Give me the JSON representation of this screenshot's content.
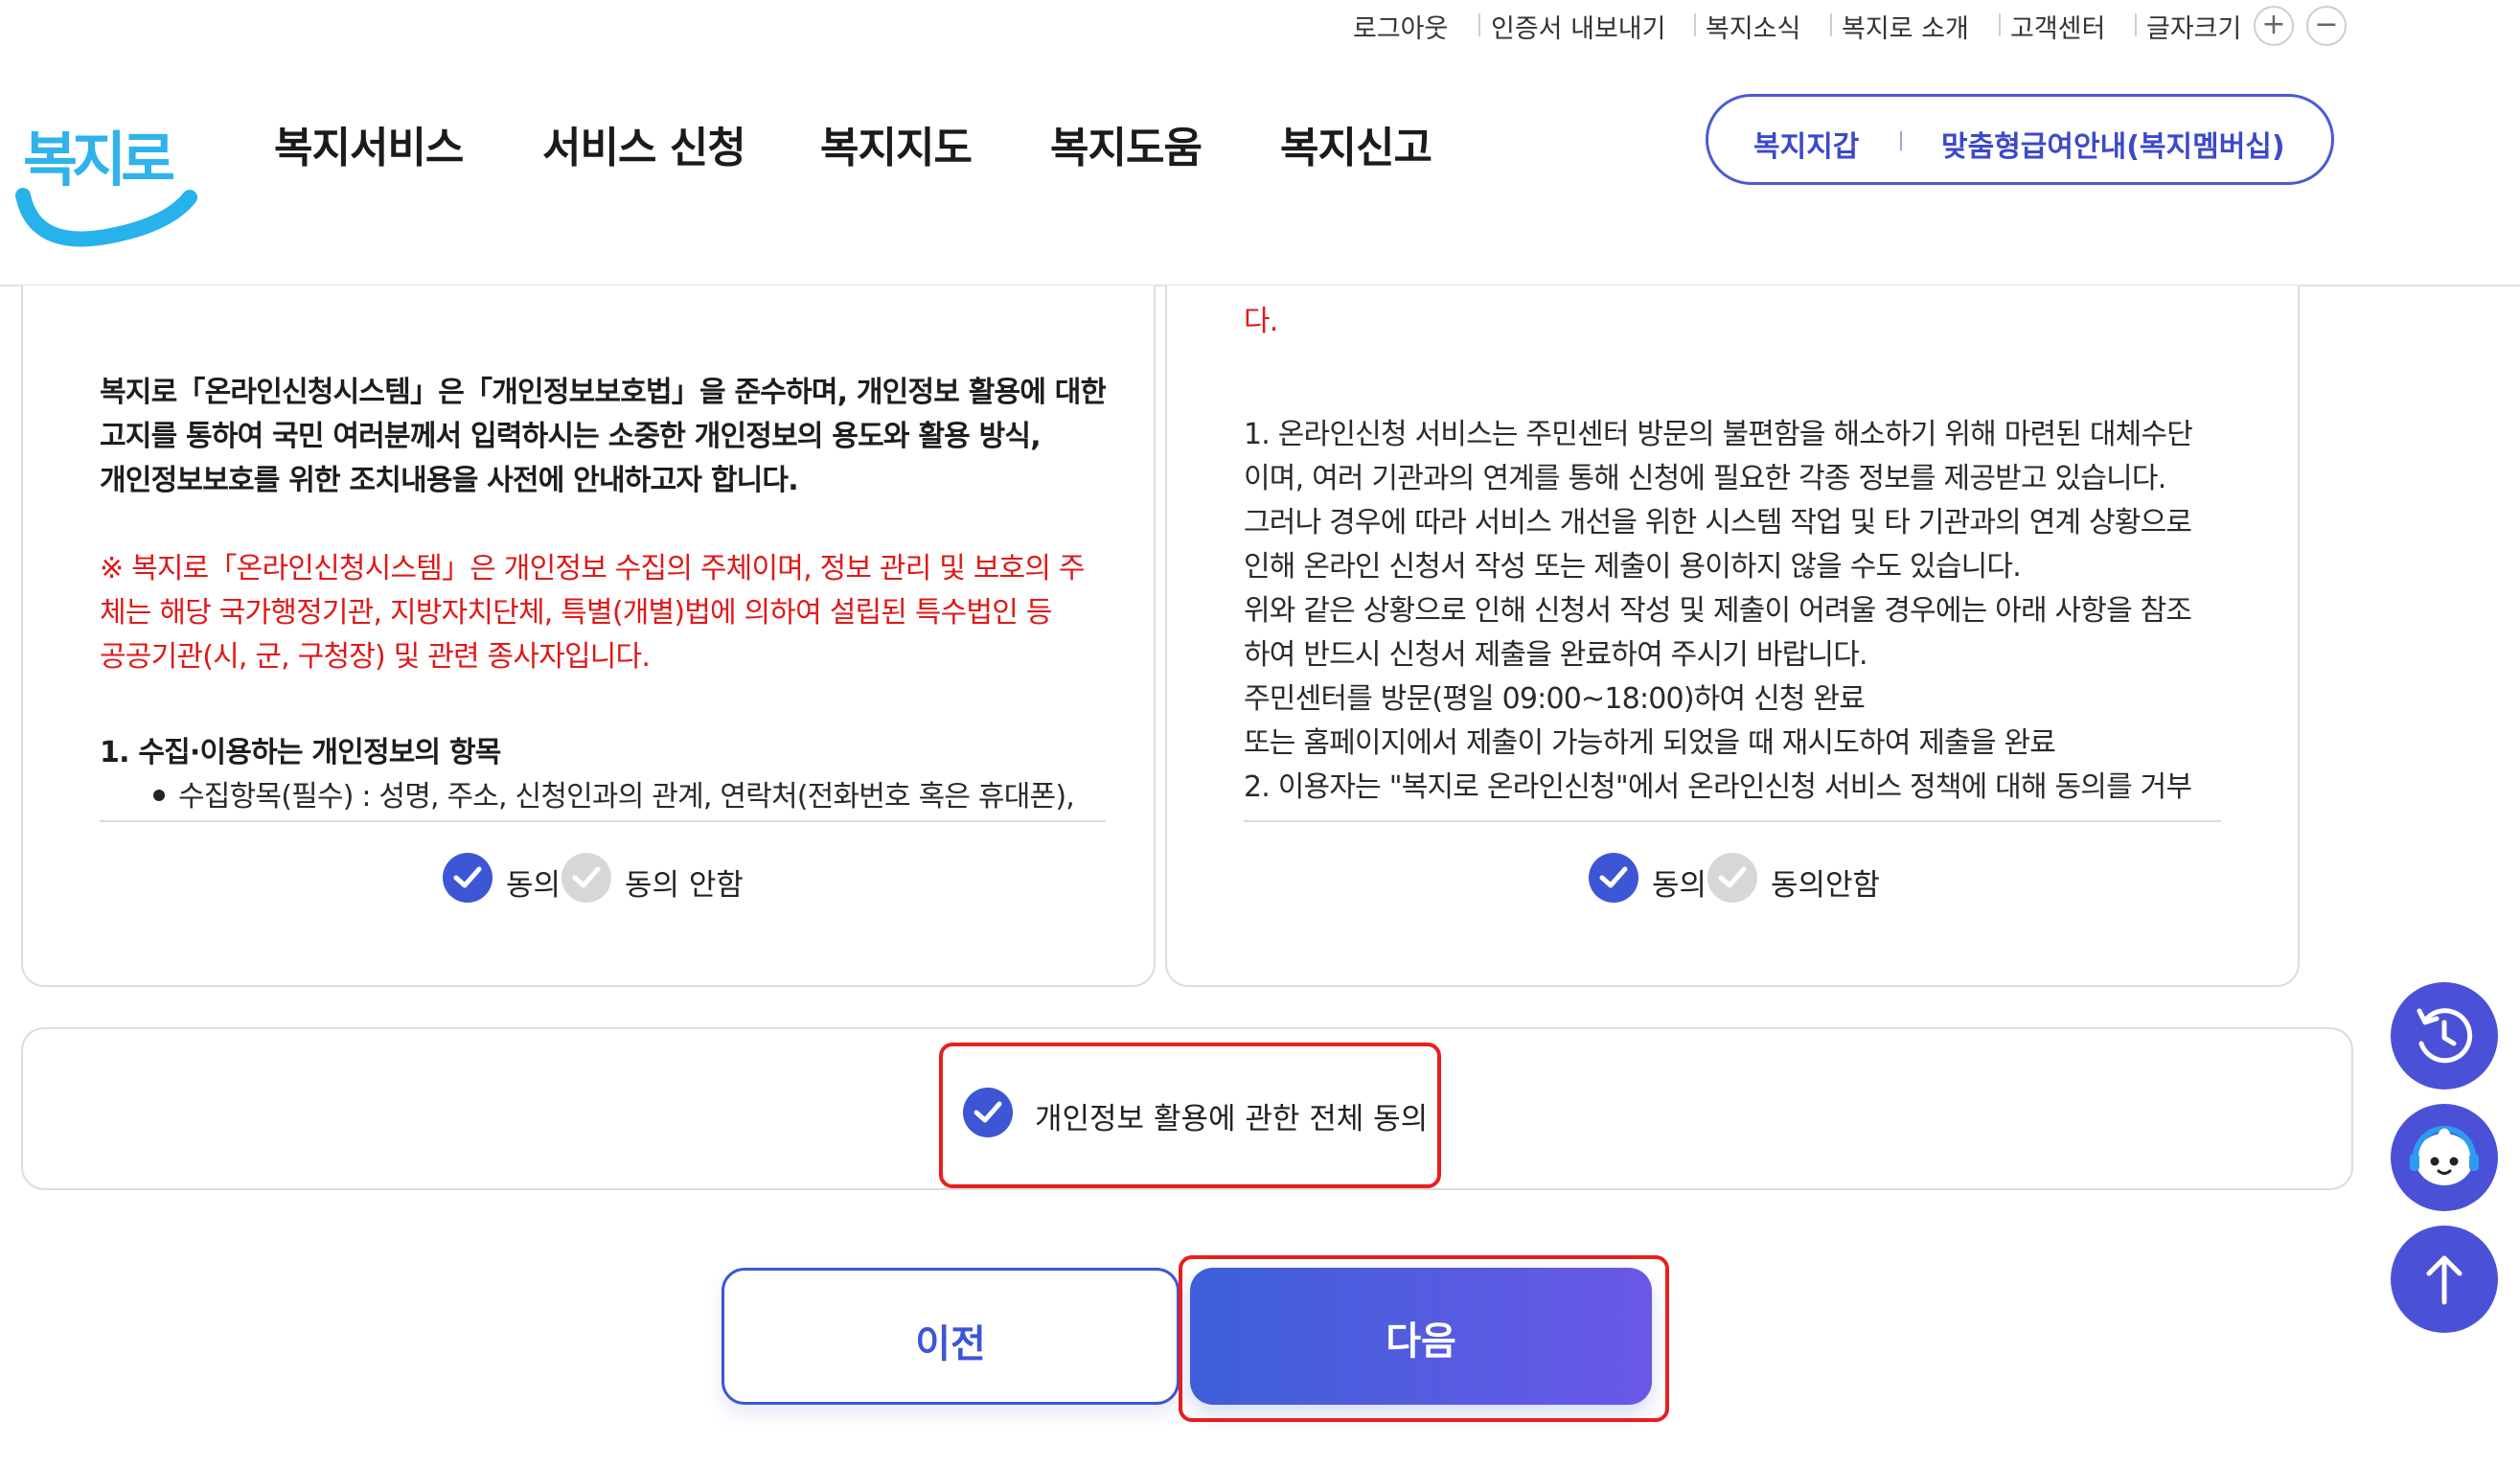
{
  "utility": {
    "logout": "로그아웃",
    "export_cert": "인증서 내보내기",
    "news": "복지소식",
    "about": "복지로 소개",
    "support": "고객센터",
    "font_size": "글자크기",
    "font_plus": "+",
    "font_minus": "−"
  },
  "logo": {
    "text": "복지로"
  },
  "gnb": {
    "services": "복지서비스",
    "apply": "서비스 신청",
    "map": "복지지도",
    "help": "복지도움",
    "report": "복지신고"
  },
  "quick": {
    "wallet": "복지지갑",
    "custom": "맞춤형급여안내(복지멤버십)"
  },
  "left_panel": {
    "intro": [
      "복지로「온라인신청시스템」은「개인정보보호법」을 준수하며, 개인정보 활용에 대한",
      "고지를 통하여 국민 여러분께서 입력하시는 소중한 개인정보의 용도와 활용 방식,",
      "개인정보보호를 위한 조치내용을 사전에 안내하고자 합니다."
    ],
    "notice": [
      "※ 복지로「온라인신청시스템」은 개인정보 수집의 주체이며, 정보 관리 및 보호의 주",
      "체는 해당 국가행정기관, 지방자치단체, 특별(개별)법에 의하여 설립된 특수법인 등",
      "공공기관(시, 군, 구청장) 및 관련 종사자입니다."
    ],
    "section_title": "1. 수집·이용하는 개인정보의 항목",
    "bullet_item": "수집항목(필수) : 성명, 주소, 신청인과의 관계, 연락처(전화번호 혹은 휴대폰),",
    "agree": "동의",
    "disagree": "동의 안함"
  },
  "right_panel": {
    "top_fragment": "다.",
    "lines": [
      "1. 온라인신청 서비스는 주민센터 방문의 불편함을 해소하기 위해 마련된 대체수단",
      "이며, 여러 기관과의 연계를 통해 신청에 필요한 각종 정보를 제공받고 있습니다.",
      "그러나 경우에 따라 서비스 개선을 위한 시스템 작업 및 타 기관과의 연계 상황으로",
      "인해 온라인 신청서 작성 또는 제출이 용이하지 않을 수도 있습니다.",
      "위와 같은 상황으로 인해 신청서 작성 및 제출이 어려울 경우에는 아래 사항을 참조",
      "하여 반드시 신청서 제출을 완료하여 주시기 바랍니다.",
      "주민센터를 방문(평일 09:00~18:00)하여 신청 완료",
      "또는 홈페이지에서 제출이 가능하게 되었을 때 재시도하여 제출을 완료",
      "2. 이용자는 \"복지로 온라인신청\"에서 온라인신청 서비스 정책에 대해 동의를 거부"
    ],
    "agree": "동의",
    "disagree": "동의안함"
  },
  "total_consent": {
    "label": "개인정보 활용에 관한 전체 동의"
  },
  "buttons": {
    "prev": "이전",
    "next": "다음"
  },
  "colors": {
    "accent": "#3d56d6",
    "highlight": "#ea1e1e",
    "notice_red": "#e01818"
  }
}
